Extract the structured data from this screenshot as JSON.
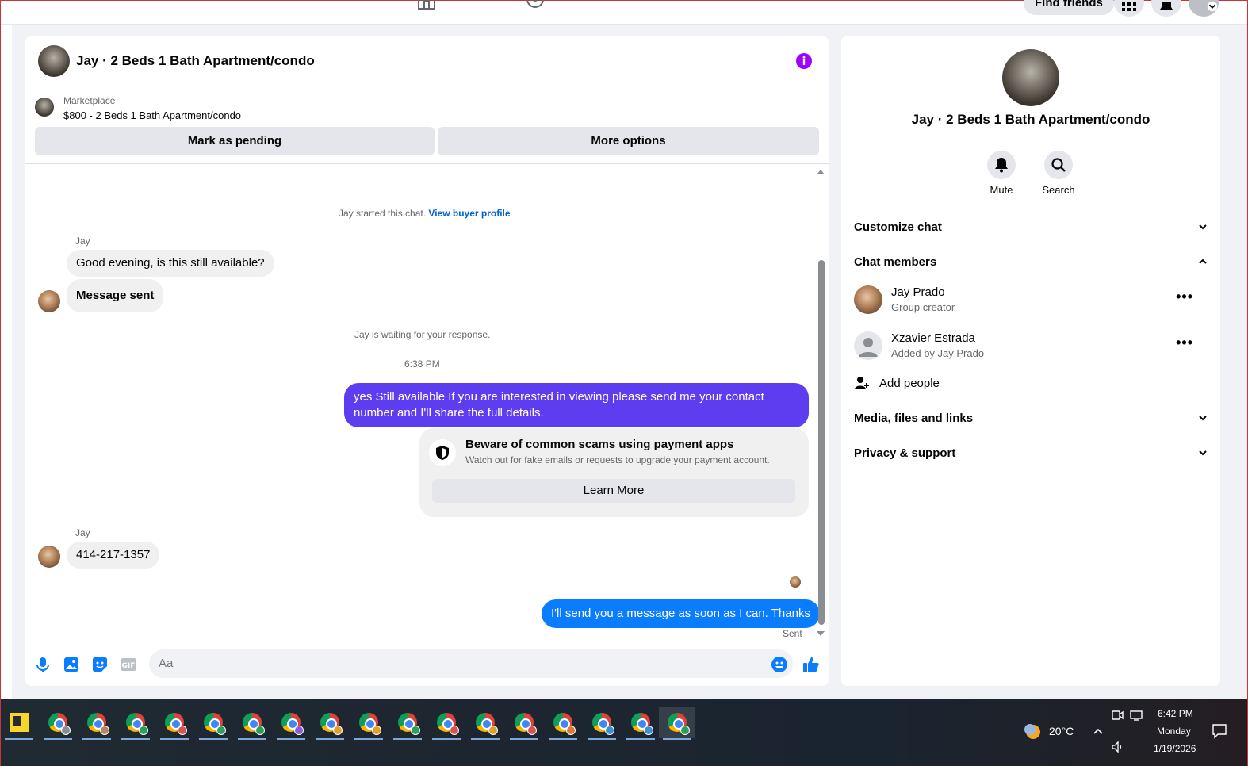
{
  "topnav": {
    "find_friends": "Find friends"
  },
  "chat": {
    "title": "Jay · 2 Beds 1 Bath Apartment/condo",
    "listing": {
      "source": "Marketplace",
      "title": "$800 - 2 Beds 1 Bath Apartment/condo"
    },
    "buttons": {
      "mark_pending": "Mark as pending",
      "more_options": "More options"
    },
    "started_text": "Jay started this chat.",
    "view_buyer_profile": "View buyer profile",
    "messages": [
      {
        "sender": "Jay",
        "text": "Good evening, is this still available?"
      },
      {
        "text": "Message sent"
      }
    ],
    "waiting_text": "Jay is waiting for your response.",
    "timestamp": "6:38 PM",
    "outgoing_1": "yes Still available If you are interested in viewing please send me your contact number and I'll share the full details.",
    "scam": {
      "title": "Beware of common scams using payment apps",
      "desc": "Watch out for fake emails or requests to upgrade your payment account.",
      "learn_more": "Learn More"
    },
    "reply_sender": "Jay",
    "reply_text": "414-217-1357",
    "outgoing_2": "I'll send you a message as soon as I can. Thanks",
    "sent_status": "Sent",
    "composer_placeholder": "Aa",
    "colors": {
      "outgoing_purple": "#5e3cf0",
      "outgoing_blue": "#0a7cff",
      "link": "#0064d1",
      "accent": "#a100ff"
    }
  },
  "info_panel": {
    "title": "Jay · 2 Beds 1 Bath Apartment/condo",
    "actions": [
      {
        "label": "Mute",
        "icon": "bell-icon"
      },
      {
        "label": "Search",
        "icon": "search-icon"
      }
    ],
    "customize_chat": "Customize chat",
    "chat_members": "Chat members",
    "members": [
      {
        "name": "Jay Prado",
        "sub": "Group creator"
      },
      {
        "name": "Xzavier Estrada",
        "sub": "Added by Jay Prado"
      }
    ],
    "add_people": "Add people",
    "media_files": "Media, files and links",
    "privacy": "Privacy & support"
  },
  "taskbar": {
    "weather": "20°C",
    "time": "6:42 PM",
    "day": "Monday",
    "date": "1/19/2026"
  }
}
